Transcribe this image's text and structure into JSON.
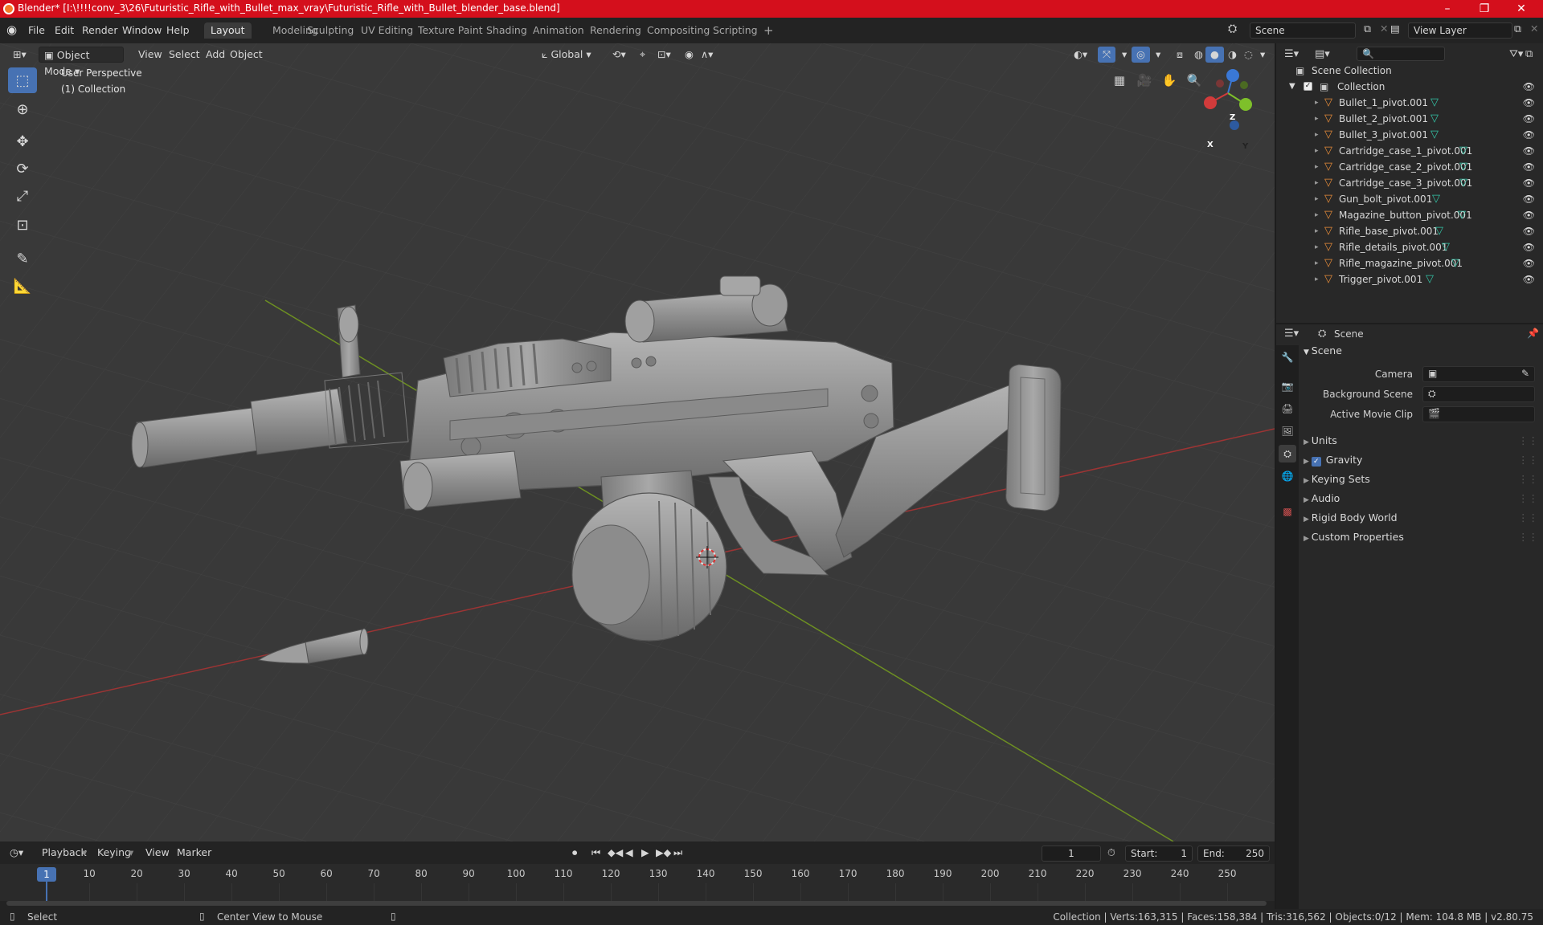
{
  "window": {
    "title": "Blender* [I:\\!!!!conv_3\\26\\Futuristic_Rifle_with_Bullet_max_vray\\Futuristic_Rifle_with_Bullet_blender_base.blend]",
    "minimize": "–",
    "maximize": "❐",
    "close": "✕"
  },
  "menubar": {
    "items": [
      "File",
      "Edit",
      "Render",
      "Window",
      "Help"
    ],
    "workspaces": [
      "Layout",
      "Modeling",
      "Sculpting",
      "UV Editing",
      "Texture Paint",
      "Shading",
      "Animation",
      "Rendering",
      "Compositing",
      "Scripting"
    ],
    "active_workspace": "Layout",
    "add_tab": "+",
    "scene": "Scene",
    "view_layer": "View Layer"
  },
  "viewport_header": {
    "mode": "Object Mode",
    "menus": [
      "View",
      "Select",
      "Add",
      "Object"
    ],
    "orientation": "Global"
  },
  "viewport": {
    "perspective": "User Perspective",
    "collection": "(1) Collection",
    "gizmo": {
      "x": "X",
      "y": "Y",
      "z": "Z"
    }
  },
  "outliner": {
    "search_placeholder": "",
    "root": "Scene Collection",
    "collection": "Collection",
    "objects": [
      "Bullet_1_pivot.001",
      "Bullet_2_pivot.001",
      "Bullet_3_pivot.001",
      "Cartridge_case_1_pivot.001",
      "Cartridge_case_2_pivot.001",
      "Cartridge_case_3_pivot.001",
      "Gun_bolt_pivot.001",
      "Magazine_button_pivot.001",
      "Rifle_base_pivot.001",
      "Rifle_details_pivot.001",
      "Rifle_magazine_pivot.001",
      "Trigger_pivot.001"
    ]
  },
  "properties": {
    "context": "Scene",
    "panel": "Scene",
    "fields": {
      "camera": "Camera",
      "background_scene": "Background Scene",
      "active_movie_clip": "Active Movie Clip"
    },
    "sections": [
      "Units",
      "Gravity",
      "Keying Sets",
      "Audio",
      "Rigid Body World",
      "Custom Properties"
    ],
    "gravity_checked": true
  },
  "timeline": {
    "menus": [
      "Playback",
      "Keying",
      "View",
      "Marker"
    ],
    "current_frame": "1",
    "start_label": "Start:",
    "start": "1",
    "end_label": "End:",
    "end": "250",
    "ticks": [
      "1",
      "10",
      "20",
      "30",
      "40",
      "50",
      "60",
      "70",
      "80",
      "90",
      "100",
      "110",
      "120",
      "130",
      "140",
      "150",
      "160",
      "170",
      "180",
      "190",
      "200",
      "210",
      "220",
      "230",
      "240",
      "250"
    ]
  },
  "statusbar": {
    "select": "Select",
    "center": "Center View to Mouse",
    "stats": "Collection | Verts:163,315 | Faces:158,384 | Tris:316,562 | Objects:0/12 | Mem: 104.8 MB | v2.80.75"
  },
  "colors": {
    "accent": "#4772b3",
    "titlebar": "#d40f1c",
    "object_icon": "#e88d3a",
    "mesh_icon": "#34c6a8",
    "x_axis": "#c63b3b",
    "y_axis": "#7aa32a"
  }
}
